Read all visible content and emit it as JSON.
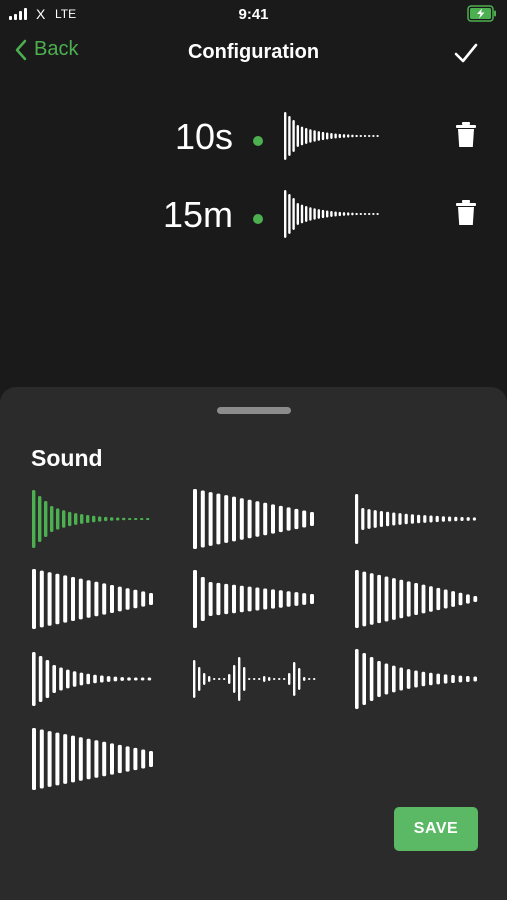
{
  "status_bar": {
    "carrier": "X",
    "network": "LTE",
    "time": "9:41",
    "battery_color": "#4caf50"
  },
  "nav": {
    "back_label": "Back",
    "title": "Configuration",
    "back_icon": "chevron-left-icon",
    "confirm_icon": "checkmark-icon"
  },
  "alarms": [
    {
      "time": "10s",
      "sound_index": 0
    },
    {
      "time": "15m",
      "sound_index": 0
    }
  ],
  "sheet": {
    "title": "Sound",
    "save_label": "SAVE",
    "selected_index": 0,
    "sounds": [
      {
        "id": "decay-fast"
      },
      {
        "id": "decay-wide"
      },
      {
        "id": "decay-sparse"
      },
      {
        "id": "decay-long"
      },
      {
        "id": "decay-medium"
      },
      {
        "id": "decay-slow"
      },
      {
        "id": "decay-short"
      },
      {
        "id": "pulses"
      },
      {
        "id": "decay-dense"
      },
      {
        "id": "decay-tall"
      }
    ]
  },
  "colors": {
    "accent": "#4caf50",
    "save_button": "#5bb865",
    "background": "#1a1a1a",
    "sheet": "#2b2b2b"
  }
}
